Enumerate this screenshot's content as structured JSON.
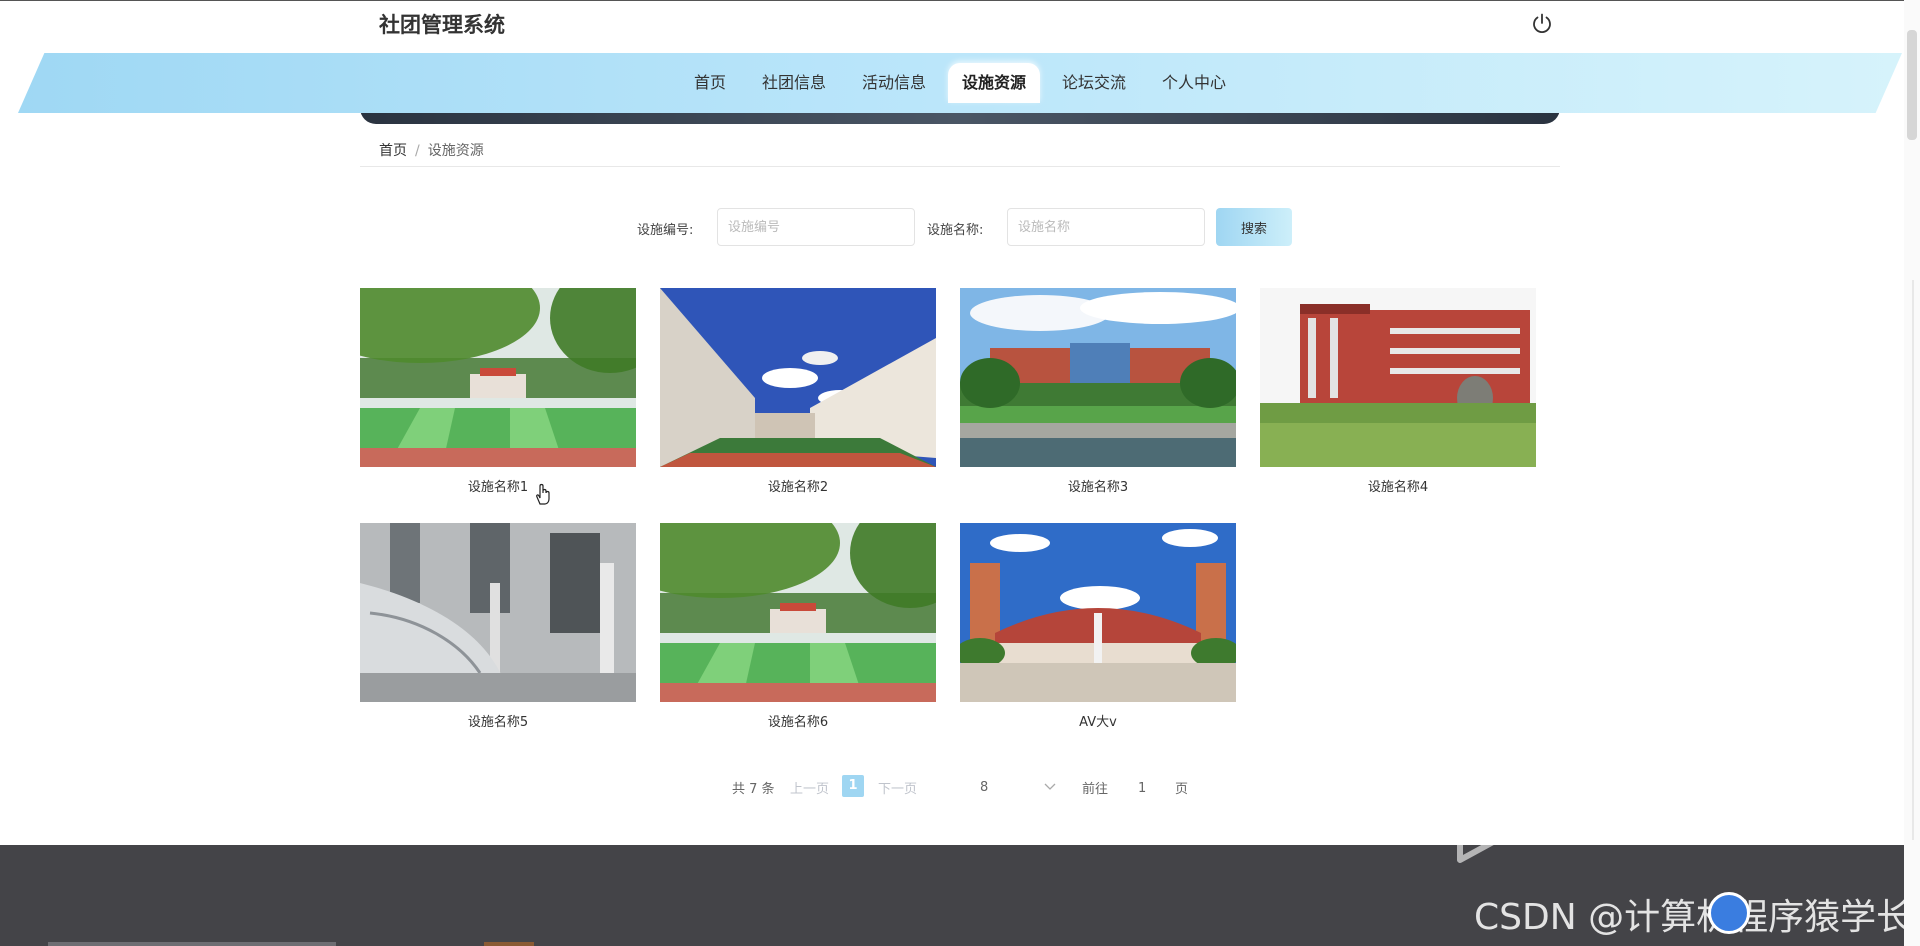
{
  "header": {
    "title": "社团管理系统"
  },
  "nav": {
    "items": [
      {
        "label": "首页",
        "active": false
      },
      {
        "label": "社团信息",
        "active": false
      },
      {
        "label": "活动信息",
        "active": false
      },
      {
        "label": "设施资源",
        "active": true
      },
      {
        "label": "论坛交流",
        "active": false
      },
      {
        "label": "个人中心",
        "active": false
      }
    ]
  },
  "breadcrumb": {
    "home": "首页",
    "separator": "/",
    "current": "设施资源"
  },
  "search": {
    "code_label": "设施编号:",
    "code_placeholder": "设施编号",
    "name_label": "设施名称:",
    "name_placeholder": "设施名称",
    "button_label": "搜索"
  },
  "facilities": [
    {
      "name": "设施名称1",
      "image": "campus-sports-field"
    },
    {
      "name": "设施名称2",
      "image": "campus-building-courtyard"
    },
    {
      "name": "设施名称3",
      "image": "campus-main-building-pond"
    },
    {
      "name": "设施名称4",
      "image": "red-teaching-building"
    },
    {
      "name": "设施名称5",
      "image": "ev-charging-station"
    },
    {
      "name": "设施名称6",
      "image": "campus-sports-field"
    },
    {
      "name": "AV大v",
      "image": "campus-gate-plaza"
    }
  ],
  "pagination": {
    "total": "共 7 条",
    "prev": "上一页",
    "current_page": "1",
    "next": "下一页",
    "page_size": "8",
    "goto_label": "前往",
    "goto_value": "1",
    "page_unit": "页"
  },
  "footer": {
    "watermark": "CSDN @计算机程序猿学长"
  },
  "colors": {
    "accent": "#9fd6f2",
    "nav_gradient_start": "#9fd8f4",
    "footer": "#444448"
  }
}
